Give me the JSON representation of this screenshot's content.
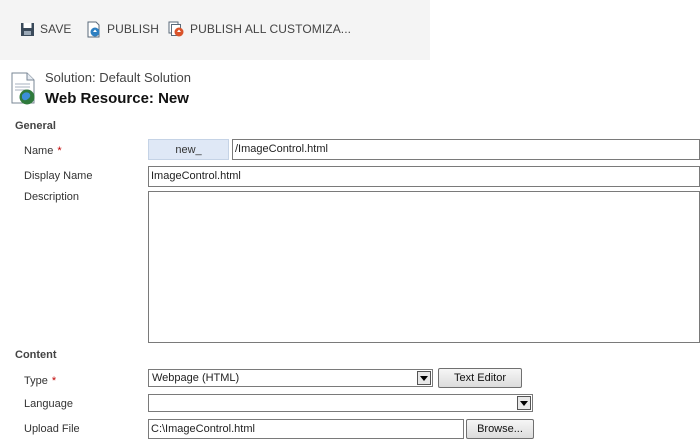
{
  "toolbar": {
    "save_label": "SAVE",
    "publish_label": "PUBLISH",
    "publish_all_label": "PUBLISH ALL CUSTOMIZA..."
  },
  "header": {
    "solution": "Solution: Default Solution",
    "title": "Web Resource: New"
  },
  "general": {
    "section_title": "General",
    "name_label": "Name",
    "required_mark": "*",
    "name_prefix": "new_",
    "name_value": "/ImageControl.html",
    "display_name_label": "Display Name",
    "display_name_value": "ImageControl.html",
    "description_label": "Description",
    "description_value": ""
  },
  "content": {
    "section_title": "Content",
    "type_label": "Type",
    "type_value": "Webpage (HTML)",
    "text_editor_label": "Text Editor",
    "language_label": "Language",
    "language_value": "",
    "upload_label": "Upload File",
    "upload_value": "C:\\ImageControl.html",
    "browse_label": "Browse..."
  },
  "colors": {
    "required": "#c00000",
    "prefix_bg": "#dfe8f6",
    "toolbar_bg": "#f4f4f4"
  },
  "icons": [
    "save-icon",
    "publish-icon",
    "publish-all-icon",
    "web-resource-icon",
    "dropdown-arrow-icon"
  ]
}
